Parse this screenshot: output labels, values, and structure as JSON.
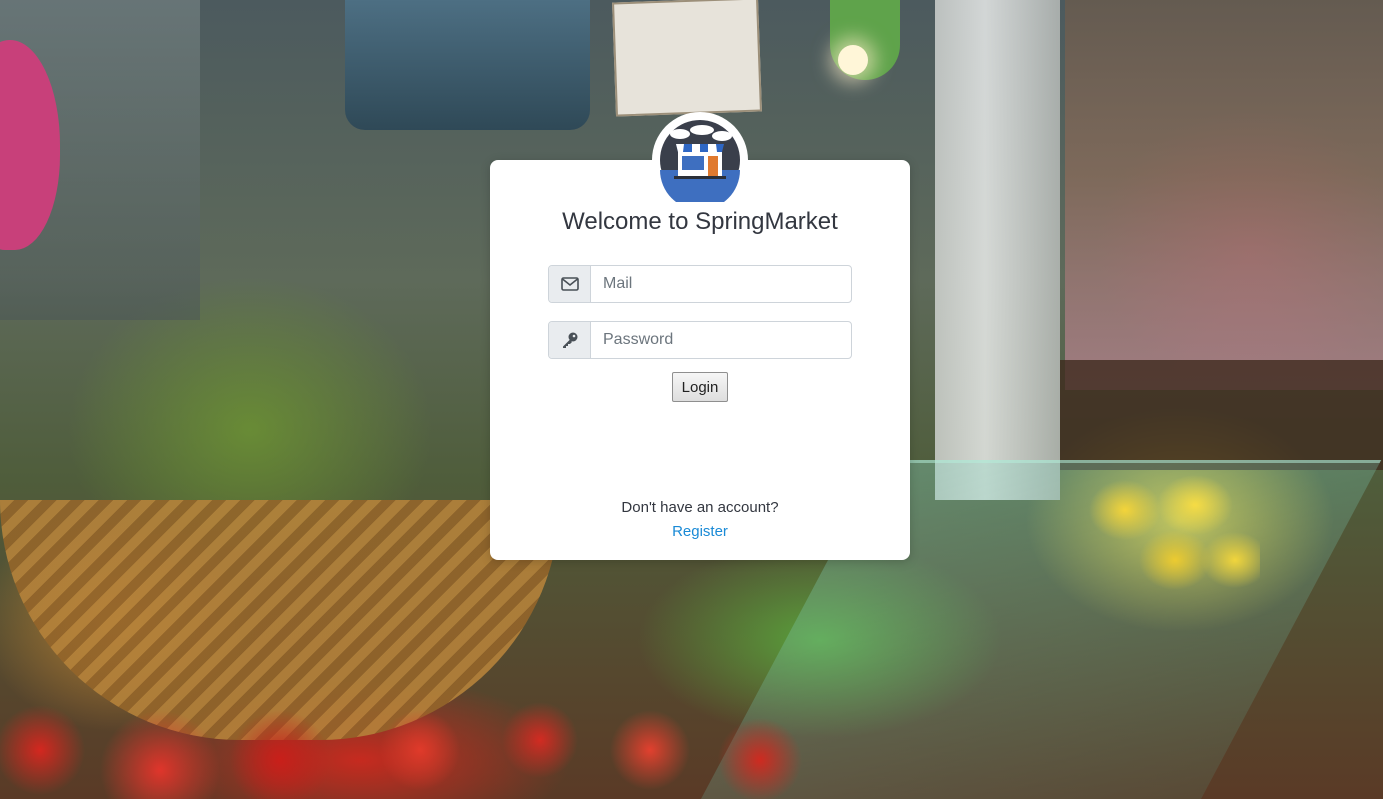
{
  "login": {
    "title": "Welcome to SpringMarket",
    "mail_placeholder": "Mail",
    "password_placeholder": "Password",
    "login_label": "Login",
    "no_account_text": "Don't have an account?",
    "register_label": "Register"
  },
  "icons": {
    "logo": "storefront-logo-icon",
    "mail": "envelope-icon",
    "password": "key-icon"
  },
  "colors": {
    "link": "#1a8ad6",
    "title_text": "#333740",
    "addon_bg": "#e9ecef",
    "card_bg": "#ffffff"
  }
}
